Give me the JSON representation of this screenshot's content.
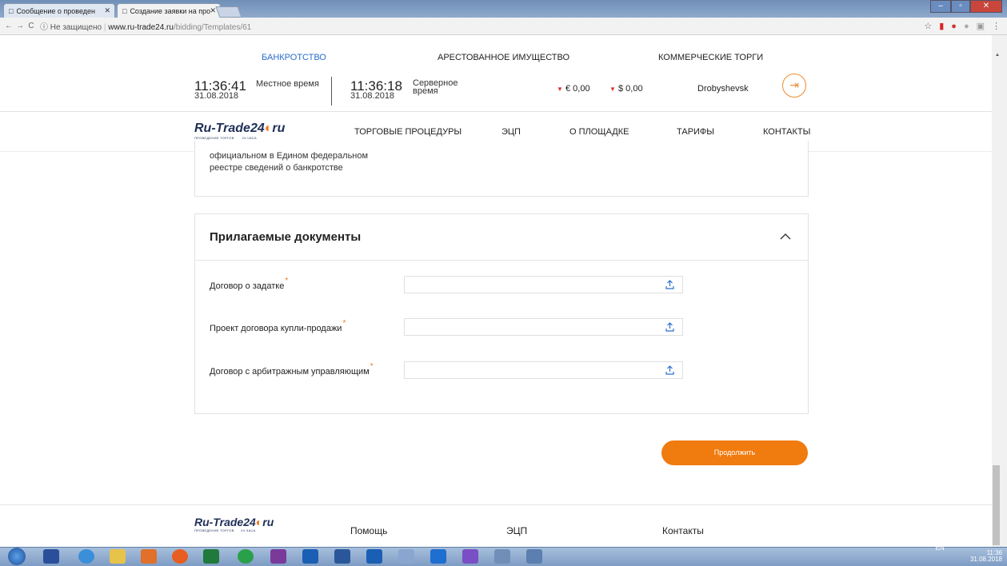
{
  "browser": {
    "tabs": [
      {
        "label": "Сообщение о проведен",
        "active": false
      },
      {
        "label": "Создание заявки на про",
        "active": true
      }
    ],
    "security": "Не защищено",
    "url_host": "www.ru-trade24.ru",
    "url_path": "/bidding/Templates/61"
  },
  "topnav": {
    "items": [
      "БАНКРОТСТВО",
      "АРЕСТОВАННОЕ ИМУЩЕСТВО",
      "КОММЕРЧЕСКИЕ ТОРГИ"
    ],
    "active_color": "#2a6ecb"
  },
  "timebar": {
    "local_time": "11:36:41",
    "local_date": "31.08.2018",
    "local_label": "Местное время",
    "server_time": "11:36:18",
    "server_date": "31.08.2018",
    "server_label_1": "Серверное",
    "server_label_2": "время",
    "euro": "€ 0,00",
    "usd": "$ 0,00",
    "user": "Drobyshevsk"
  },
  "mainnav": {
    "logo_main": "Ru-Trade24",
    "logo_ru": "ru",
    "logo_sub_left": "ПРОВЕДЕНИЕ ТОРГОВ",
    "logo_sub_right": "24 ЧАСА",
    "items": [
      "ТОРГОВЫЕ ПРОЦЕДУРЫ",
      "ЭЦП",
      "О ПЛОЩАДКЕ",
      "ТАРИФЫ",
      "КОНТАКТЫ"
    ]
  },
  "card_top": {
    "line1": "официальном в Едином федеральном",
    "line2": "реестре сведений о банкротстве"
  },
  "documents": {
    "title": "Прилагаемые документы",
    "fields": [
      {
        "label": "Договор о задатке"
      },
      {
        "label": "Проект договора купли-продажи"
      },
      {
        "label": "Договор с арбитражным управляющим"
      }
    ]
  },
  "continue_label": "Продолжить",
  "accent": "#f07b0e",
  "footer": {
    "items": [
      "Помощь",
      "ЭЦП",
      "Контакты"
    ]
  },
  "tray": {
    "lang": "EN",
    "time": "11:36",
    "date": "31.08.2018"
  }
}
